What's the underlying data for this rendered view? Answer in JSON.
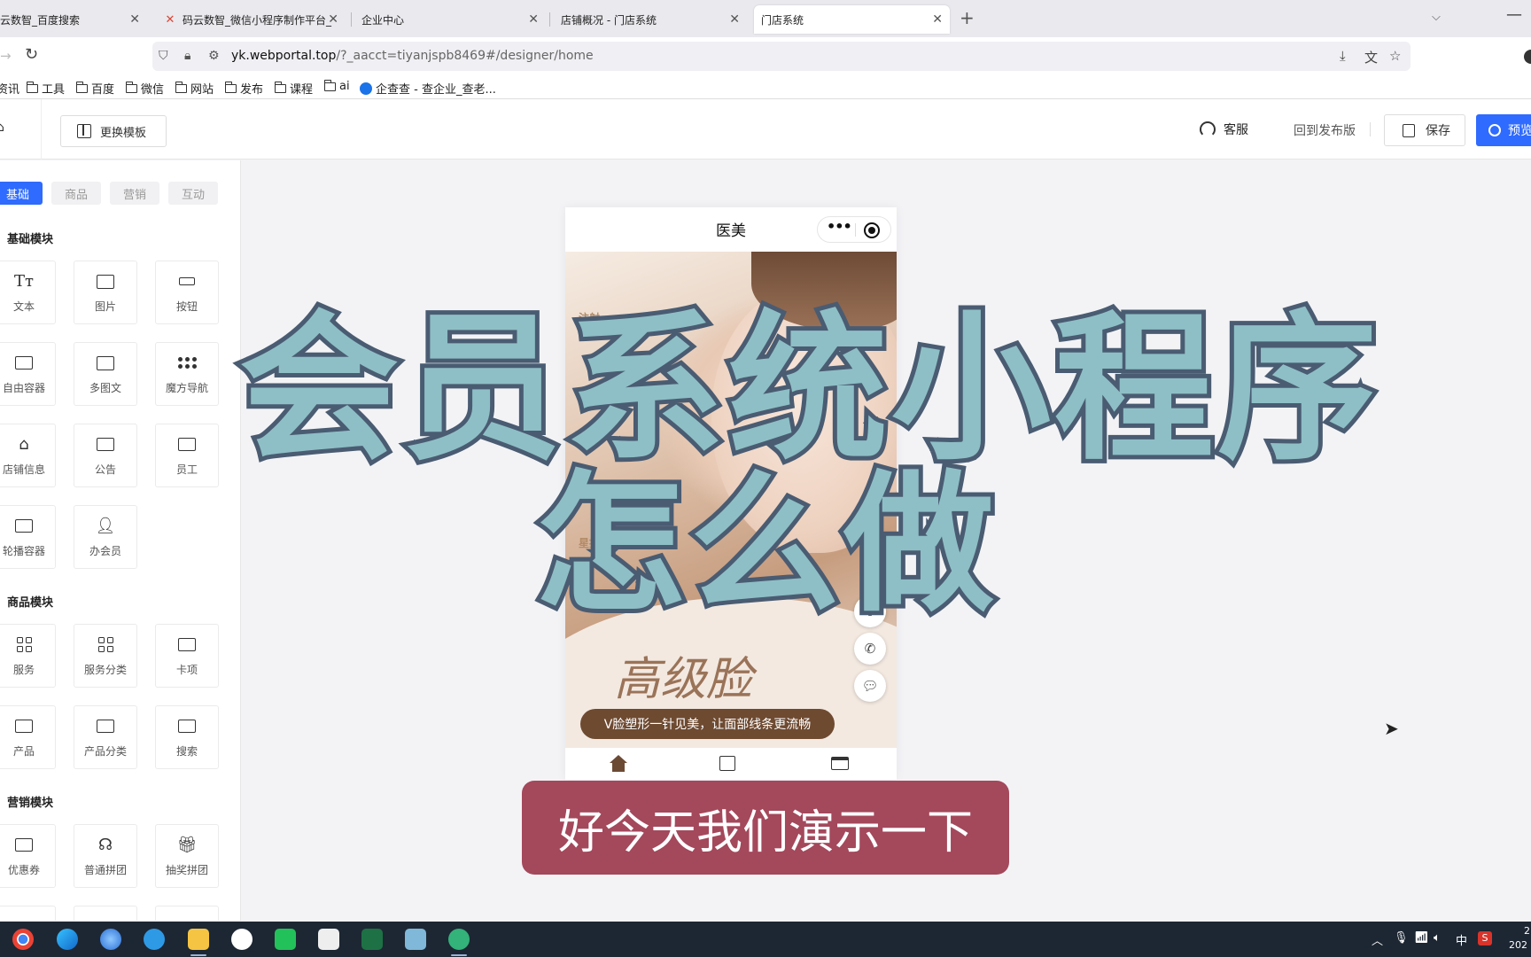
{
  "browser": {
    "tabs": [
      {
        "title": "云数智_百度搜索",
        "active": false
      },
      {
        "title": "码云数智_微信小程序制作平台_",
        "active": false
      },
      {
        "title": "企业中心",
        "active": false
      },
      {
        "title": "店铺概况 - 门店系统",
        "active": false
      },
      {
        "title": "门店系统",
        "active": true
      }
    ],
    "new_tab_glyph": "+",
    "url_host": "yk.webportal.top",
    "url_path": "/?_aacct=tiyanjspb8469#/designer/home",
    "bookmarks": [
      "资讯",
      "工具",
      "百度",
      "微信",
      "网站",
      "发布",
      "课程",
      "ai",
      "企查查 - 查企业_查老..."
    ]
  },
  "header": {
    "change_template": "更换模板",
    "customer_service": "客服",
    "back_to_published": "回到发布版",
    "save": "保存",
    "preview": "预览"
  },
  "panel": {
    "tabs": [
      "基础",
      "商品",
      "营销",
      "互动"
    ],
    "active_tab": "基础",
    "sections": [
      {
        "title": "基础模块",
        "items": [
          "文本",
          "图片",
          "按钮",
          "自由容器",
          "多图文",
          "魔方导航",
          "店铺信息",
          "公告",
          "员工",
          "轮播容器",
          "办会员"
        ]
      },
      {
        "title": "商品模块",
        "items": [
          "服务",
          "服务分类",
          "卡项",
          "产品",
          "产品分类",
          "搜索"
        ]
      },
      {
        "title": "营销模块",
        "items": [
          "优惠券",
          "普通拼团",
          "抽奖拼团"
        ]
      }
    ]
  },
  "phone": {
    "title": "医美",
    "banner_heading": "高级脸",
    "banner_vertical_text": "注射",
    "banner_vertical_text_2": "星提",
    "banner_slogan": "V脸塑形一针见美，让面部线条更流畅"
  },
  "overlay": {
    "title_line1": "会员系统小程序",
    "title_line2": "怎么做",
    "subtitle": "好今天我们演示一下"
  },
  "taskbar": {
    "tray_ime": "中",
    "clock_time": "2",
    "clock_date": "202"
  },
  "colors": {
    "accent": "#2f6bff",
    "title_fill": "#8ebfc6",
    "title_stroke": "#4a5c72",
    "subtitle_bg": "#a4485c",
    "slogan_bg": "#6e4a31"
  }
}
